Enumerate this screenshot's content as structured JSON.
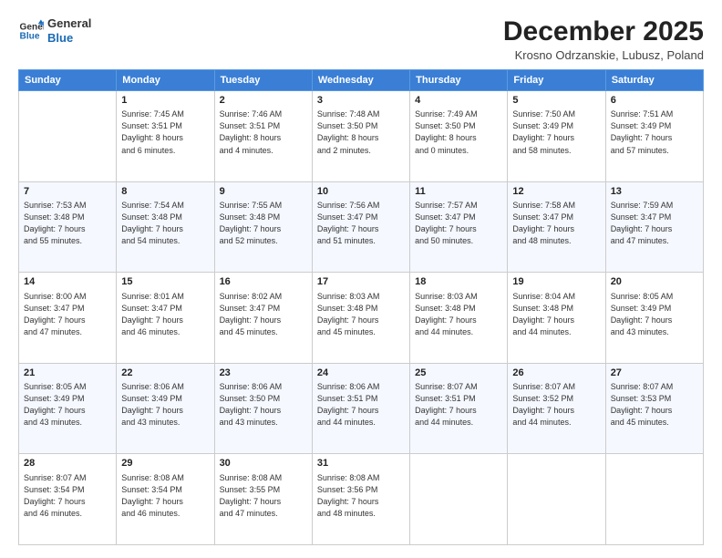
{
  "header": {
    "logo_line1": "General",
    "logo_line2": "Blue",
    "month": "December 2025",
    "location": "Krosno Odrzanskie, Lubusz, Poland"
  },
  "days_of_week": [
    "Sunday",
    "Monday",
    "Tuesday",
    "Wednesday",
    "Thursday",
    "Friday",
    "Saturday"
  ],
  "weeks": [
    [
      {
        "day": "",
        "info": ""
      },
      {
        "day": "1",
        "info": "Sunrise: 7:45 AM\nSunset: 3:51 PM\nDaylight: 8 hours\nand 6 minutes."
      },
      {
        "day": "2",
        "info": "Sunrise: 7:46 AM\nSunset: 3:51 PM\nDaylight: 8 hours\nand 4 minutes."
      },
      {
        "day": "3",
        "info": "Sunrise: 7:48 AM\nSunset: 3:50 PM\nDaylight: 8 hours\nand 2 minutes."
      },
      {
        "day": "4",
        "info": "Sunrise: 7:49 AM\nSunset: 3:50 PM\nDaylight: 8 hours\nand 0 minutes."
      },
      {
        "day": "5",
        "info": "Sunrise: 7:50 AM\nSunset: 3:49 PM\nDaylight: 7 hours\nand 58 minutes."
      },
      {
        "day": "6",
        "info": "Sunrise: 7:51 AM\nSunset: 3:49 PM\nDaylight: 7 hours\nand 57 minutes."
      }
    ],
    [
      {
        "day": "7",
        "info": "Sunrise: 7:53 AM\nSunset: 3:48 PM\nDaylight: 7 hours\nand 55 minutes."
      },
      {
        "day": "8",
        "info": "Sunrise: 7:54 AM\nSunset: 3:48 PM\nDaylight: 7 hours\nand 54 minutes."
      },
      {
        "day": "9",
        "info": "Sunrise: 7:55 AM\nSunset: 3:48 PM\nDaylight: 7 hours\nand 52 minutes."
      },
      {
        "day": "10",
        "info": "Sunrise: 7:56 AM\nSunset: 3:47 PM\nDaylight: 7 hours\nand 51 minutes."
      },
      {
        "day": "11",
        "info": "Sunrise: 7:57 AM\nSunset: 3:47 PM\nDaylight: 7 hours\nand 50 minutes."
      },
      {
        "day": "12",
        "info": "Sunrise: 7:58 AM\nSunset: 3:47 PM\nDaylight: 7 hours\nand 48 minutes."
      },
      {
        "day": "13",
        "info": "Sunrise: 7:59 AM\nSunset: 3:47 PM\nDaylight: 7 hours\nand 47 minutes."
      }
    ],
    [
      {
        "day": "14",
        "info": "Sunrise: 8:00 AM\nSunset: 3:47 PM\nDaylight: 7 hours\nand 47 minutes."
      },
      {
        "day": "15",
        "info": "Sunrise: 8:01 AM\nSunset: 3:47 PM\nDaylight: 7 hours\nand 46 minutes."
      },
      {
        "day": "16",
        "info": "Sunrise: 8:02 AM\nSunset: 3:47 PM\nDaylight: 7 hours\nand 45 minutes."
      },
      {
        "day": "17",
        "info": "Sunrise: 8:03 AM\nSunset: 3:48 PM\nDaylight: 7 hours\nand 45 minutes."
      },
      {
        "day": "18",
        "info": "Sunrise: 8:03 AM\nSunset: 3:48 PM\nDaylight: 7 hours\nand 44 minutes."
      },
      {
        "day": "19",
        "info": "Sunrise: 8:04 AM\nSunset: 3:48 PM\nDaylight: 7 hours\nand 44 minutes."
      },
      {
        "day": "20",
        "info": "Sunrise: 8:05 AM\nSunset: 3:49 PM\nDaylight: 7 hours\nand 43 minutes."
      }
    ],
    [
      {
        "day": "21",
        "info": "Sunrise: 8:05 AM\nSunset: 3:49 PM\nDaylight: 7 hours\nand 43 minutes."
      },
      {
        "day": "22",
        "info": "Sunrise: 8:06 AM\nSunset: 3:49 PM\nDaylight: 7 hours\nand 43 minutes."
      },
      {
        "day": "23",
        "info": "Sunrise: 8:06 AM\nSunset: 3:50 PM\nDaylight: 7 hours\nand 43 minutes."
      },
      {
        "day": "24",
        "info": "Sunrise: 8:06 AM\nSunset: 3:51 PM\nDaylight: 7 hours\nand 44 minutes."
      },
      {
        "day": "25",
        "info": "Sunrise: 8:07 AM\nSunset: 3:51 PM\nDaylight: 7 hours\nand 44 minutes."
      },
      {
        "day": "26",
        "info": "Sunrise: 8:07 AM\nSunset: 3:52 PM\nDaylight: 7 hours\nand 44 minutes."
      },
      {
        "day": "27",
        "info": "Sunrise: 8:07 AM\nSunset: 3:53 PM\nDaylight: 7 hours\nand 45 minutes."
      }
    ],
    [
      {
        "day": "28",
        "info": "Sunrise: 8:07 AM\nSunset: 3:54 PM\nDaylight: 7 hours\nand 46 minutes."
      },
      {
        "day": "29",
        "info": "Sunrise: 8:08 AM\nSunset: 3:54 PM\nDaylight: 7 hours\nand 46 minutes."
      },
      {
        "day": "30",
        "info": "Sunrise: 8:08 AM\nSunset: 3:55 PM\nDaylight: 7 hours\nand 47 minutes."
      },
      {
        "day": "31",
        "info": "Sunrise: 8:08 AM\nSunset: 3:56 PM\nDaylight: 7 hours\nand 48 minutes."
      },
      {
        "day": "",
        "info": ""
      },
      {
        "day": "",
        "info": ""
      },
      {
        "day": "",
        "info": ""
      }
    ]
  ]
}
